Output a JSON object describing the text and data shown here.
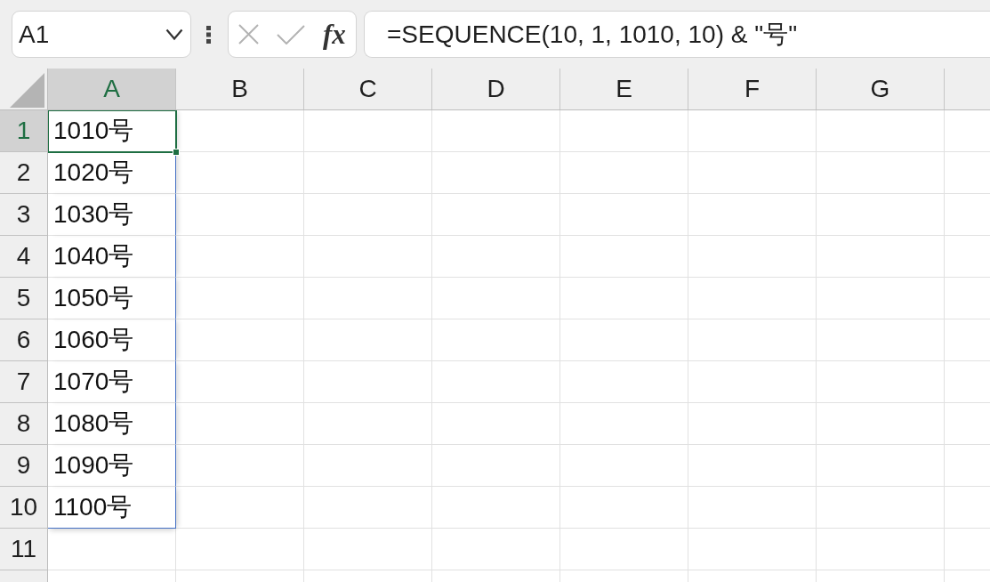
{
  "name_box": {
    "value": "A1"
  },
  "formula_bar": {
    "buttons": [
      {
        "kind": "cancel",
        "disabled": true
      },
      {
        "kind": "enter",
        "disabled": true
      },
      {
        "kind": "function",
        "label": "fx",
        "disabled": false
      }
    ],
    "formula": "=SEQUENCE(10, 1, 1010, 10) & \"号\""
  },
  "sheet": {
    "columns": [
      {
        "label": "A",
        "selected": true
      },
      {
        "label": "B",
        "selected": false
      },
      {
        "label": "C",
        "selected": false
      },
      {
        "label": "D",
        "selected": false
      },
      {
        "label": "E",
        "selected": false
      },
      {
        "label": "F",
        "selected": false
      },
      {
        "label": "G",
        "selected": false
      }
    ],
    "rows": [
      {
        "label": "1",
        "selected": true,
        "cells": [
          {
            "value": "1010号",
            "selected": true,
            "spill": true
          }
        ]
      },
      {
        "label": "2",
        "selected": false,
        "cells": [
          {
            "value": "1020号",
            "selected": false,
            "spill": true
          }
        ]
      },
      {
        "label": "3",
        "selected": false,
        "cells": [
          {
            "value": "1030号",
            "selected": false,
            "spill": true
          }
        ]
      },
      {
        "label": "4",
        "selected": false,
        "cells": [
          {
            "value": "1040号",
            "selected": false,
            "spill": true
          }
        ]
      },
      {
        "label": "5",
        "selected": false,
        "cells": [
          {
            "value": "1050号",
            "selected": false,
            "spill": true
          }
        ]
      },
      {
        "label": "6",
        "selected": false,
        "cells": [
          {
            "value": "1060号",
            "selected": false,
            "spill": true
          }
        ]
      },
      {
        "label": "7",
        "selected": false,
        "cells": [
          {
            "value": "1070号",
            "selected": false,
            "spill": true
          }
        ]
      },
      {
        "label": "8",
        "selected": false,
        "cells": [
          {
            "value": "1080号",
            "selected": false,
            "spill": true
          }
        ]
      },
      {
        "label": "9",
        "selected": false,
        "cells": [
          {
            "value": "1090号",
            "selected": false,
            "spill": true
          }
        ]
      },
      {
        "label": "10",
        "selected": false,
        "cells": [
          {
            "value": "1100号",
            "selected": false,
            "spill": true
          }
        ]
      },
      {
        "label": "11",
        "selected": false
      }
    ]
  }
}
